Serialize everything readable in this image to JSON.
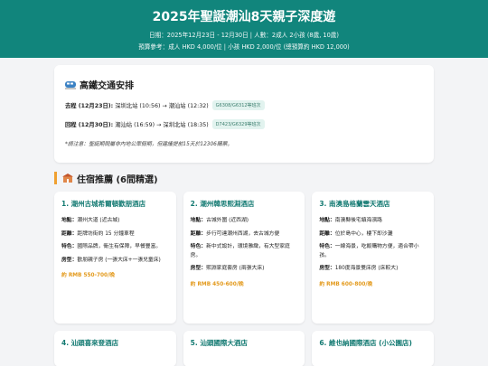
{
  "header": {
    "title": "2025年聖誕潮汕8天親子深度遊",
    "line1": "日期：2025年12月23日 - 12月30日 | 人數：2成人 2小孩 (8歲, 10歲)",
    "line2": "預算參考：成人 HKD 4,000/位 | 小孩 HKD 2,000/位 (總預算約 HKD 12,000)"
  },
  "transport": {
    "title": "高鐵交通安排",
    "outbound": {
      "label": "去程 (12月23日):",
      "route": "深圳北站 (10:56) → 潮汕站 (12:32)",
      "badge": "G6308/G6312等班次"
    },
    "return": {
      "label": "回程 (12月30日):",
      "route": "潮汕站 (16:59) → 深圳北站 (18:35)",
      "badge": "D7423/G6329等班次"
    },
    "note": "*請注意：聖誕期間屬非內地公眾假期，但建議提前15天於12306購票。"
  },
  "hotels": {
    "title": "住宿推薦 (6間精選)",
    "labels": {
      "location": "地點：",
      "distance": "距離：",
      "feature": "特色：",
      "room": "房型："
    },
    "items": [
      {
        "name": "1. 潮州古城希爾頓歡朋酒店",
        "location": "潮州大道 (近古城)",
        "distance": "距牌坊街約 15 分鐘車程",
        "feature": "國際品牌，衛生有保障，早餐豐富。",
        "room": "歡朋親子房 (一張大床+一張兒童床)",
        "price": "約 RMB 550-700/晚"
      },
      {
        "name": "2. 潮州韓思熙淵酒店",
        "location": "古城外圍 (近西湖)",
        "distance": "步行可達潮州西湖，去古城方便",
        "feature": "新中式設計，環境雅緻，有大型家庭房。",
        "room": "熙淵家庭套房 (兩張大床)",
        "price": "約 RMB 450-600/晚"
      },
      {
        "name": "3. 南澳島格蘭雲天酒店",
        "location": "南澳縣後宅鎮海濱路",
        "distance": "位於島中心，樓下即沙灘",
        "feature": "一線海景，吃飯購物方便，適合帶小孩。",
        "room": "180度海景雙床房 (床較大)",
        "price": "約 RMB 600-800/晚"
      },
      {
        "name": "4. 汕頭喜來登酒店"
      },
      {
        "name": "5. 汕頭國際大酒店"
      },
      {
        "name": "6. 維也納國際酒店 (小公園店)"
      }
    ]
  }
}
